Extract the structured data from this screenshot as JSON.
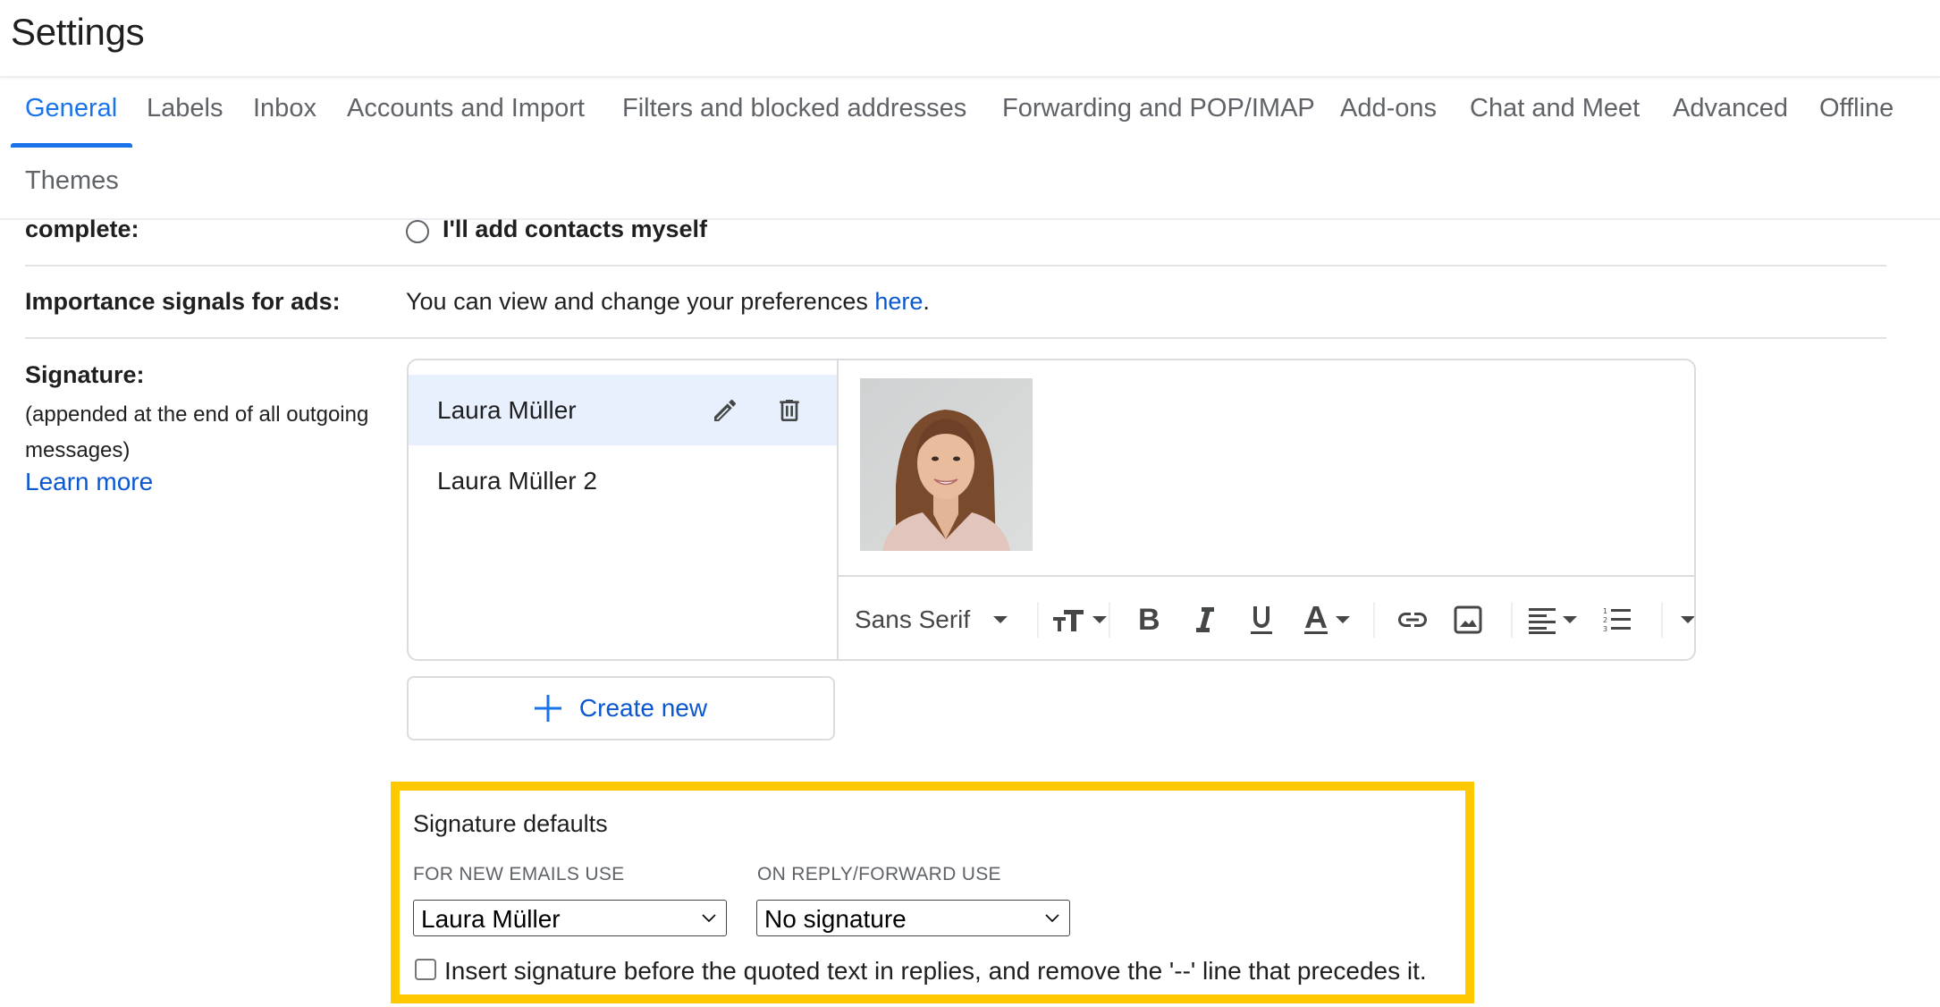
{
  "header": {
    "title": "Settings"
  },
  "tabs": [
    {
      "label": "General",
      "active": true
    },
    {
      "label": "Labels"
    },
    {
      "label": "Inbox"
    },
    {
      "label": "Accounts and Import"
    },
    {
      "label": "Filters and blocked addresses"
    },
    {
      "label": "Forwarding and POP/IMAP"
    },
    {
      "label": "Add-ons"
    },
    {
      "label": "Chat and Meet"
    },
    {
      "label": "Advanced"
    },
    {
      "label": "Offline"
    },
    {
      "label": "Themes"
    }
  ],
  "autocomplete": {
    "label": "complete:",
    "option_label": "I'll add contacts myself"
  },
  "importance": {
    "label": "Importance signals for ads:",
    "text": "You can view and change your preferences ",
    "link": "here",
    "suffix": "."
  },
  "signature": {
    "label": "Signature:",
    "description": "(appended at the end of all outgoing messages)",
    "learn_more": "Learn more",
    "items": [
      {
        "name": "Laura Müller",
        "selected": true
      },
      {
        "name": "Laura Müller 2",
        "selected": false
      }
    ],
    "photo_alt": "Portrait photo of a smiling woman with long brown hair",
    "toolbar": {
      "font": "Sans Serif",
      "icons": [
        "text-size-icon",
        "bold-icon",
        "italic-icon",
        "underline-icon",
        "text-color-icon",
        "link-icon",
        "image-icon",
        "align-icon",
        "numbered-list-icon",
        "more-options-icon"
      ]
    },
    "create_new": "Create new"
  },
  "defaults": {
    "title": "Signature defaults",
    "new_emails_label": "FOR NEW EMAILS USE",
    "new_emails_value": "Laura Müller",
    "reply_label": "ON REPLY/FORWARD USE",
    "reply_value": "No signature",
    "checkbox_label": "Insert signature before the quoted text in replies, and remove the '--' line that precedes it.",
    "checkbox_checked": false
  },
  "colors": {
    "accent": "#1a73e8",
    "link": "#0b57d0",
    "selected_row": "#e8f0fe",
    "highlight_border": "#ffc800"
  }
}
